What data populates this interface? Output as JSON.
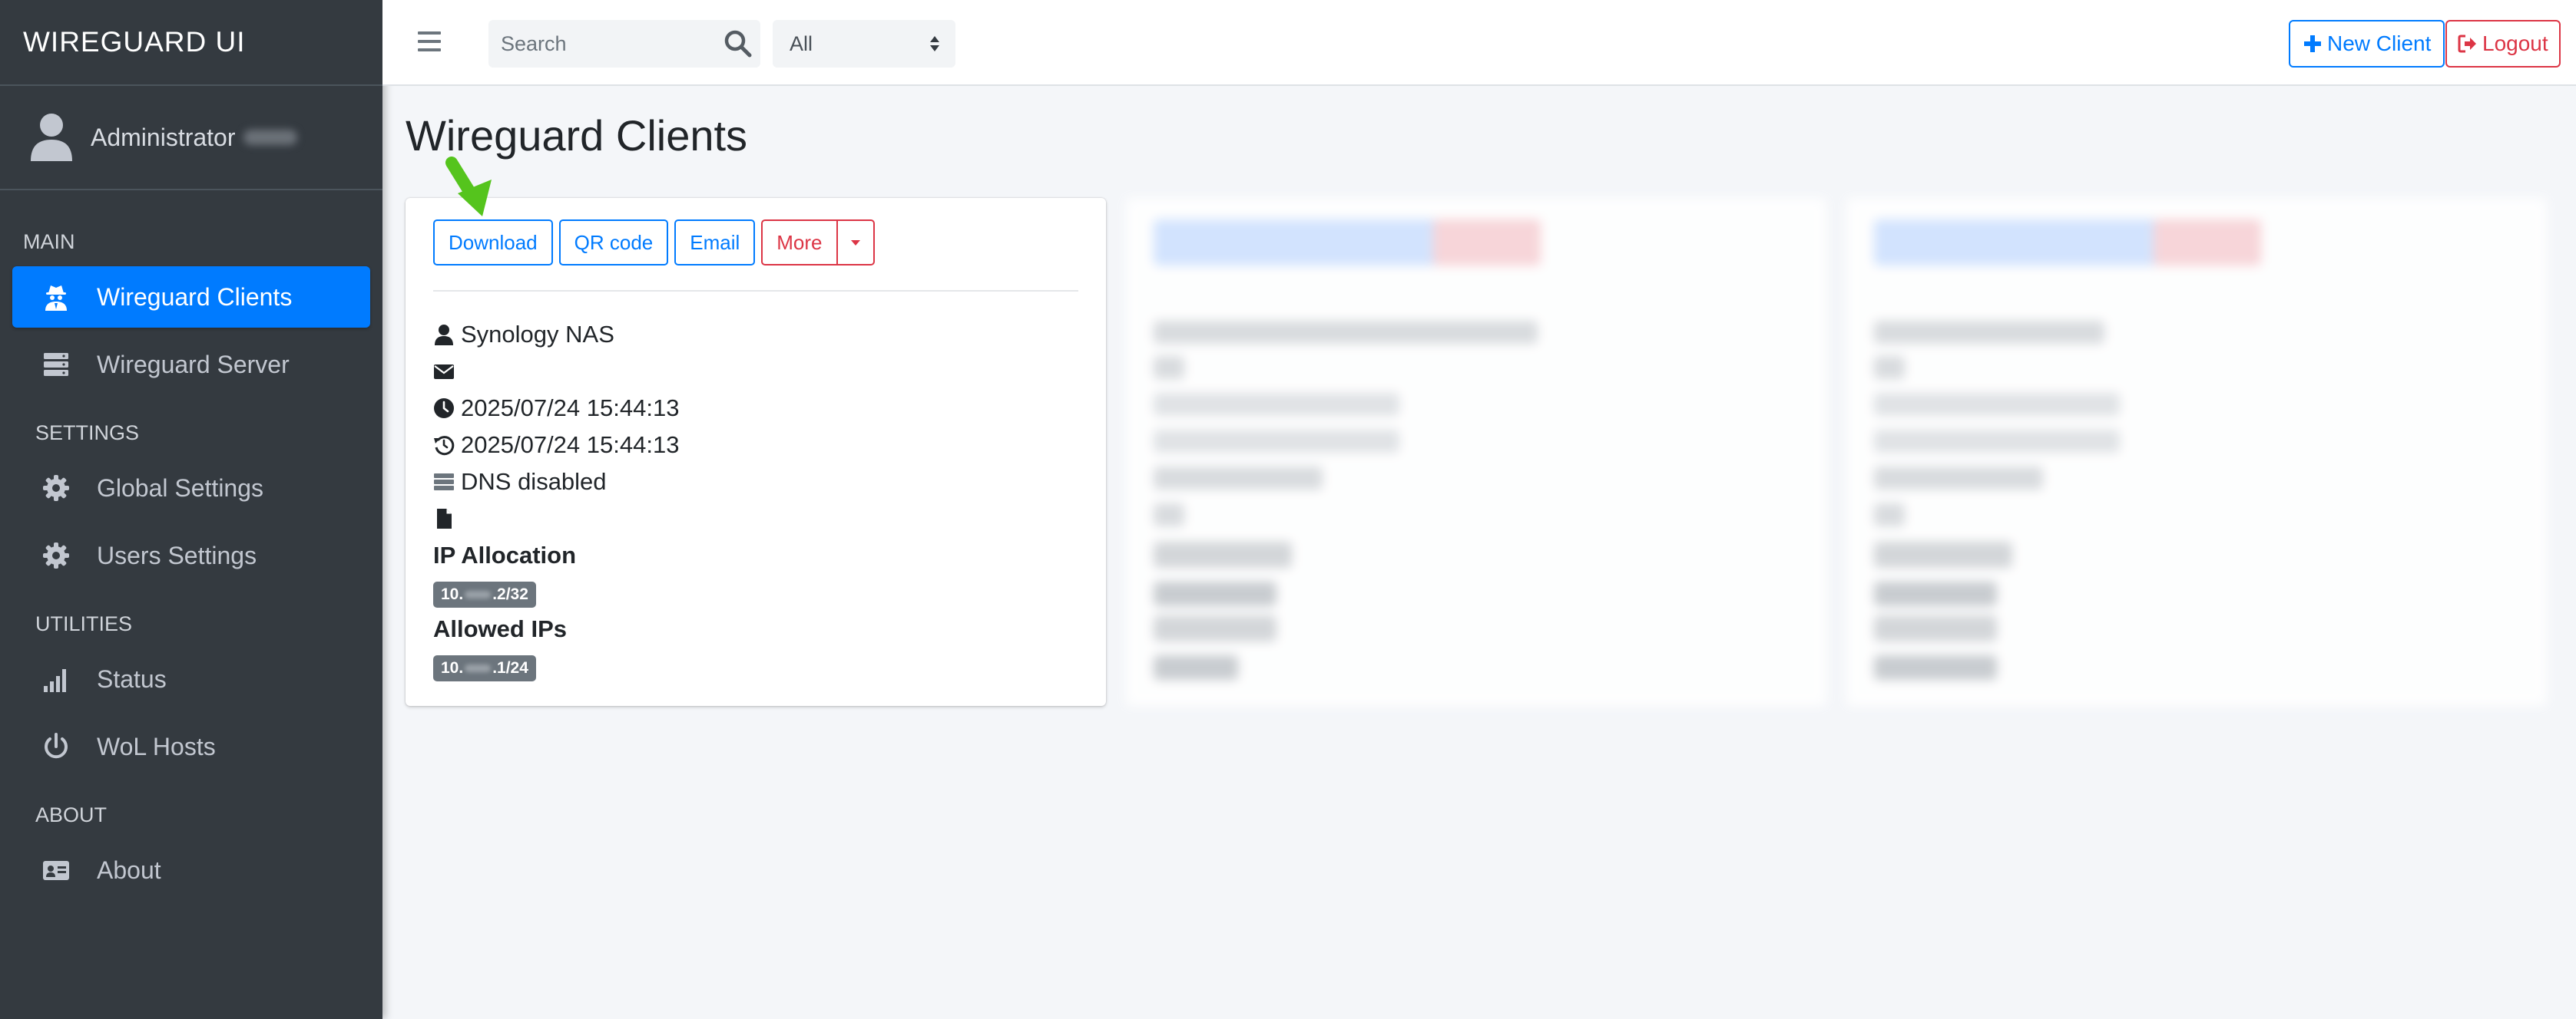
{
  "app": {
    "title": "WIREGUARD UI"
  },
  "user": {
    "name": "Administrator"
  },
  "sidebar": {
    "sections": [
      {
        "header": "MAIN",
        "items": [
          {
            "label": "Wireguard Clients",
            "icon": "user-secret-icon",
            "active": true
          },
          {
            "label": "Wireguard Server",
            "icon": "server-icon",
            "active": false
          }
        ]
      },
      {
        "header": "SETTINGS",
        "items": [
          {
            "label": "Global Settings",
            "icon": "gear-icon",
            "active": false
          },
          {
            "label": "Users Settings",
            "icon": "gear-icon",
            "active": false
          }
        ]
      },
      {
        "header": "UTILITIES",
        "items": [
          {
            "label": "Status",
            "icon": "signal-icon",
            "active": false
          },
          {
            "label": "WoL Hosts",
            "icon": "power-icon",
            "active": false
          }
        ]
      },
      {
        "header": "ABOUT",
        "items": [
          {
            "label": "About",
            "icon": "id-card-icon",
            "active": false
          }
        ]
      }
    ]
  },
  "navbar": {
    "search_placeholder": "Search",
    "filter_value": "All",
    "new_client_label": "New Client",
    "logout_label": "Logout"
  },
  "page": {
    "title": "Wireguard Clients"
  },
  "client_card": {
    "buttons": {
      "download": "Download",
      "qr": "QR code",
      "email": "Email",
      "more": "More"
    },
    "name": "Synology NAS",
    "email": "",
    "created": "2025/07/24 15:44:13",
    "updated": "2025/07/24 15:44:13",
    "dns": "DNS disabled",
    "additional_notes": "",
    "ip_allocation_label": "IP Allocation",
    "ip_allocation_prefix": "10.",
    "ip_allocation_suffix": ".2/32",
    "allowed_ips_label": "Allowed IPs",
    "allowed_ips_prefix": "10.",
    "allowed_ips_suffix": ".1/24"
  },
  "colors": {
    "primary": "#007bff",
    "danger": "#dc3545",
    "sidebar_bg": "#343a40",
    "badge_bg": "#6c757d",
    "annotation_arrow": "#55c41d"
  }
}
